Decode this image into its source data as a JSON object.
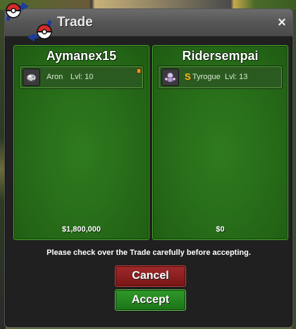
{
  "window": {
    "title": "Trade",
    "close_symbol": "×"
  },
  "left_panel": {
    "player_name": "Aymanex15",
    "pokemon": {
      "icon": "aron-icon",
      "name": "Aron",
      "level": "Lvl: 10",
      "held_item": true
    },
    "money": "$1,800,000"
  },
  "right_panel": {
    "player_name": "Ridersempai",
    "pokemon": {
      "icon": "tyrogue-icon",
      "shiny_mark": "S",
      "name": "Tyrogue",
      "level": "Lvl: 13"
    },
    "money": "$0"
  },
  "notice": "Please check over the Trade carefully before accepting.",
  "buttons": {
    "cancel": "Cancel",
    "accept": "Accept"
  },
  "colors": {
    "panel_green": "#29701a",
    "cancel_red": "#8a1e1e",
    "accept_green": "#248a20",
    "shiny_gold": "#f2c21a"
  }
}
